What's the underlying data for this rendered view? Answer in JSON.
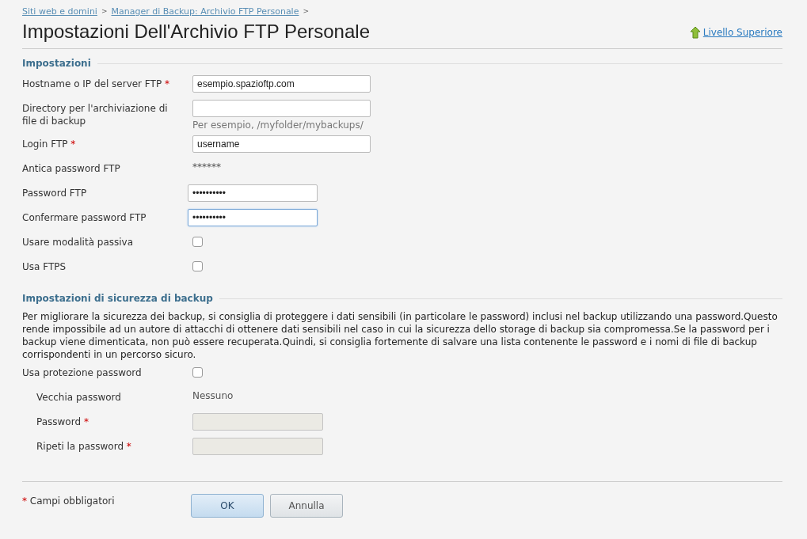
{
  "breadcrumbs": [
    {
      "label": "Siti web e domini",
      "separator": ">"
    },
    {
      "label": "Manager di Backup: Archivio FTP Personale",
      "separator": ">"
    }
  ],
  "title": "Impostazioni Dell'Archivio FTP Personale",
  "up_link": "Livello Superiore",
  "sections": [
    {
      "title": "Impostazioni",
      "rows": [
        {
          "kind": "text",
          "label": "Hostname o IP del server FTP",
          "required_mark": "*",
          "value": "esempio.spazioftp.com"
        },
        {
          "kind": "text",
          "label": "Directory per l'archiviazione di file di backup",
          "hint": "Per esempio, /myfolder/mybackups/"
        },
        {
          "kind": "text",
          "label": "Login FTP",
          "required_mark": "*",
          "value": "username"
        },
        {
          "kind": "static",
          "label": "Antica password FTP",
          "value": "******"
        },
        {
          "kind": "password",
          "label": "Password FTP",
          "value": "••••••••••",
          "focused": false
        },
        {
          "kind": "password",
          "label": "Confermare password FTP",
          "value": "••••••••••",
          "focused": true
        },
        {
          "kind": "checkbox",
          "label": "Usare modalità passiva",
          "checked": false
        },
        {
          "kind": "checkbox",
          "label": "Usa FTPS",
          "checked": false
        }
      ]
    },
    {
      "title": "Impostazioni di sicurezza di backup",
      "description": "Per migliorare la sicurezza dei backup, si consiglia di proteggere i dati sensibili (in particolare le password) inclusi nel backup utilizzando una password.Questo rende impossibile ad un autore di attacchi di ottenere dati sensibili nel caso in cui la sicurezza dello storage di backup sia compromessa.Se la password per i backup viene dimenticata, non può essere recuperata.Quindi, si consiglia fortemente di salvare una lista contenente le password e i nomi di file di backup corrispondenti in un percorso sicuro.",
      "rows": [
        {
          "kind": "checkbox",
          "label": "Usa protezione password",
          "checked": false
        },
        {
          "kind": "static",
          "label": "Vecchia password",
          "value": "Nessuno",
          "indented": true
        },
        {
          "kind": "text",
          "label": "Password",
          "required_mark": "*",
          "disabled": true,
          "indented": true
        },
        {
          "kind": "text",
          "label": "Ripeti la password",
          "required_mark": "*",
          "disabled": true,
          "indented": true
        }
      ]
    }
  ],
  "footer": {
    "required_mark": "*",
    "required_note": "Campi obbligatori",
    "buttons": [
      {
        "label": "OK",
        "primary": true
      },
      {
        "label": "Annulla",
        "primary": false
      }
    ]
  }
}
